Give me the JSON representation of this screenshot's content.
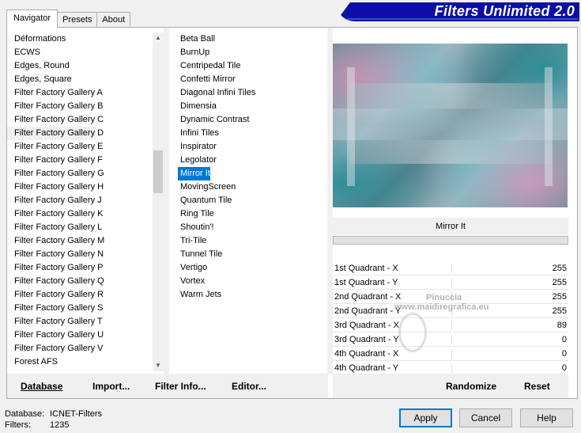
{
  "tabs": [
    "Navigator",
    "Presets",
    "About"
  ],
  "app_title": "Filters Unlimited 2.0",
  "categories": [
    "Déformations",
    "ECWS",
    "Edges, Round",
    "Edges, Square",
    "Filter Factory Gallery A",
    "Filter Factory Gallery B",
    "Filter Factory Gallery C",
    "Filter Factory Gallery D",
    "Filter Factory Gallery E",
    "Filter Factory Gallery F",
    "Filter Factory Gallery G",
    "Filter Factory Gallery H",
    "Filter Factory Gallery J",
    "Filter Factory Gallery K",
    "Filter Factory Gallery L",
    "Filter Factory Gallery M",
    "Filter Factory Gallery N",
    "Filter Factory Gallery P",
    "Filter Factory Gallery Q",
    "Filter Factory Gallery R",
    "Filter Factory Gallery S",
    "Filter Factory Gallery T",
    "Filter Factory Gallery U",
    "Filter Factory Gallery V",
    "Forest AFS"
  ],
  "hovered_category": "Filter Factory Gallery D",
  "filters": [
    "Beta Ball",
    "BurnUp",
    "Centripedal Tile",
    "Confetti Mirror",
    "Diagonal Infini Tiles",
    "Dimensia",
    "Dynamic Contrast",
    "Infini Tiles",
    "Inspirator",
    "Legolator",
    "Mirror It",
    "MovingScreen",
    "Quantum Tile",
    "Ring Tile",
    "Shoutin'!",
    "Tri-Tile",
    "Tunnel Tile",
    "Vertigo",
    "Vortex",
    "Warm Jets"
  ],
  "selected_filter": "Mirror It",
  "current_filter_name": "Mirror It",
  "params": [
    {
      "label": "1st Quadrant - X",
      "value": "255"
    },
    {
      "label": "1st Quadrant - Y",
      "value": "255"
    },
    {
      "label": "2nd Quadrant - X",
      "value": "255"
    },
    {
      "label": "2nd Quadrant - Y",
      "value": "255"
    },
    {
      "label": "3rd Quadrant - X",
      "value": "89"
    },
    {
      "label": "3rd Quadrant - Y",
      "value": "0"
    },
    {
      "label": "4th Quadrant - X",
      "value": "0"
    },
    {
      "label": "4th Quadrant - Y",
      "value": "0"
    }
  ],
  "toolbar": {
    "database": "Database",
    "import": "Import...",
    "filter_info": "Filter Info...",
    "editor": "Editor...",
    "randomize": "Randomize",
    "reset": "Reset"
  },
  "watermark": {
    "line1": "Pinuccia",
    "line2": "www.maidiregrafica.eu"
  },
  "footer": {
    "database_label": "Database:",
    "database_value": "ICNET-Filters",
    "filters_label": "Filters:",
    "filters_value": "1235"
  },
  "buttons": {
    "apply": "Apply",
    "cancel": "Cancel",
    "help": "Help"
  },
  "colors": {
    "banner": "#0d0da8",
    "selection": "#0078d7"
  }
}
